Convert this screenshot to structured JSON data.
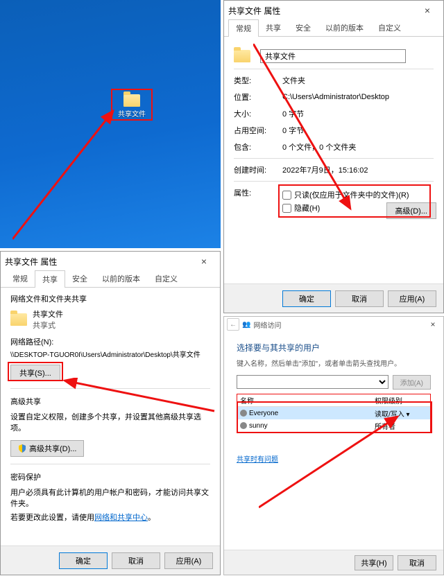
{
  "desktop": {
    "folder_label": "共享文件"
  },
  "props1": {
    "title": "共享文件 属性",
    "tabs": [
      "常规",
      "共享",
      "安全",
      "以前的版本",
      "自定义"
    ],
    "active_tab": 0,
    "name": "共享文件",
    "fields": {
      "type_k": "类型:",
      "type_v": "文件夹",
      "loc_k": "位置:",
      "loc_v": "C:\\Users\\Administrator\\Desktop",
      "size_k": "大小:",
      "size_v": "0 字节",
      "disk_k": "占用空间:",
      "disk_v": "0 字节",
      "contains_k": "包含:",
      "contains_v": "0 个文件，0 个文件夹",
      "created_k": "创建时间:",
      "created_v": "2022年7月9日，15:16:02",
      "attr_k": "属性:",
      "readonly": "只读(仅应用于文件夹中的文件)(R)",
      "hidden": "隐藏(H)",
      "advanced": "高级(D)..."
    },
    "buttons": {
      "ok": "确定",
      "cancel": "取消",
      "apply": "应用(A)"
    }
  },
  "props2": {
    "title": "共享文件 属性",
    "tabs": [
      "常规",
      "共享",
      "安全",
      "以前的版本",
      "自定义"
    ],
    "active_tab": 1,
    "section1": {
      "heading": "网络文件和文件夹共享",
      "name": "共享文件",
      "status": "共享式",
      "path_label": "网络路径(N):",
      "path": "\\\\DESKTOP-TGUOR0I\\Users\\Administrator\\Desktop\\共享文件",
      "share_btn": "共享(S)..."
    },
    "section2": {
      "heading": "高级共享",
      "desc": "设置自定义权限，创建多个共享，并设置其他高级共享选项。",
      "adv_btn": "高级共享(D)..."
    },
    "section3": {
      "heading": "密码保护",
      "line1": "用户必须具有此计算机的用户帐户和密码，才能访问共享文件夹。",
      "line2a": "若要更改此设置，请使用",
      "link": "网络和共享中心",
      "line2b": "。"
    },
    "buttons": {
      "ok": "确定",
      "cancel": "取消",
      "apply": "应用(A)"
    }
  },
  "net": {
    "breadcrumb": "网络访问",
    "heading": "选择要与其共享的用户",
    "sub": "键入名称，然后单击\"添加\"，或者单击箭头查找用户。",
    "add_btn": "添加(A)",
    "cols": {
      "name": "名称",
      "perm": "权限级别"
    },
    "rows": [
      {
        "name": "Everyone",
        "perm": "读取/写入 ▾"
      },
      {
        "name": "sunny",
        "perm": "所有者"
      }
    ],
    "trouble_link": "共享时有问题",
    "buttons": {
      "share": "共享(H)",
      "cancel": "取消"
    }
  }
}
